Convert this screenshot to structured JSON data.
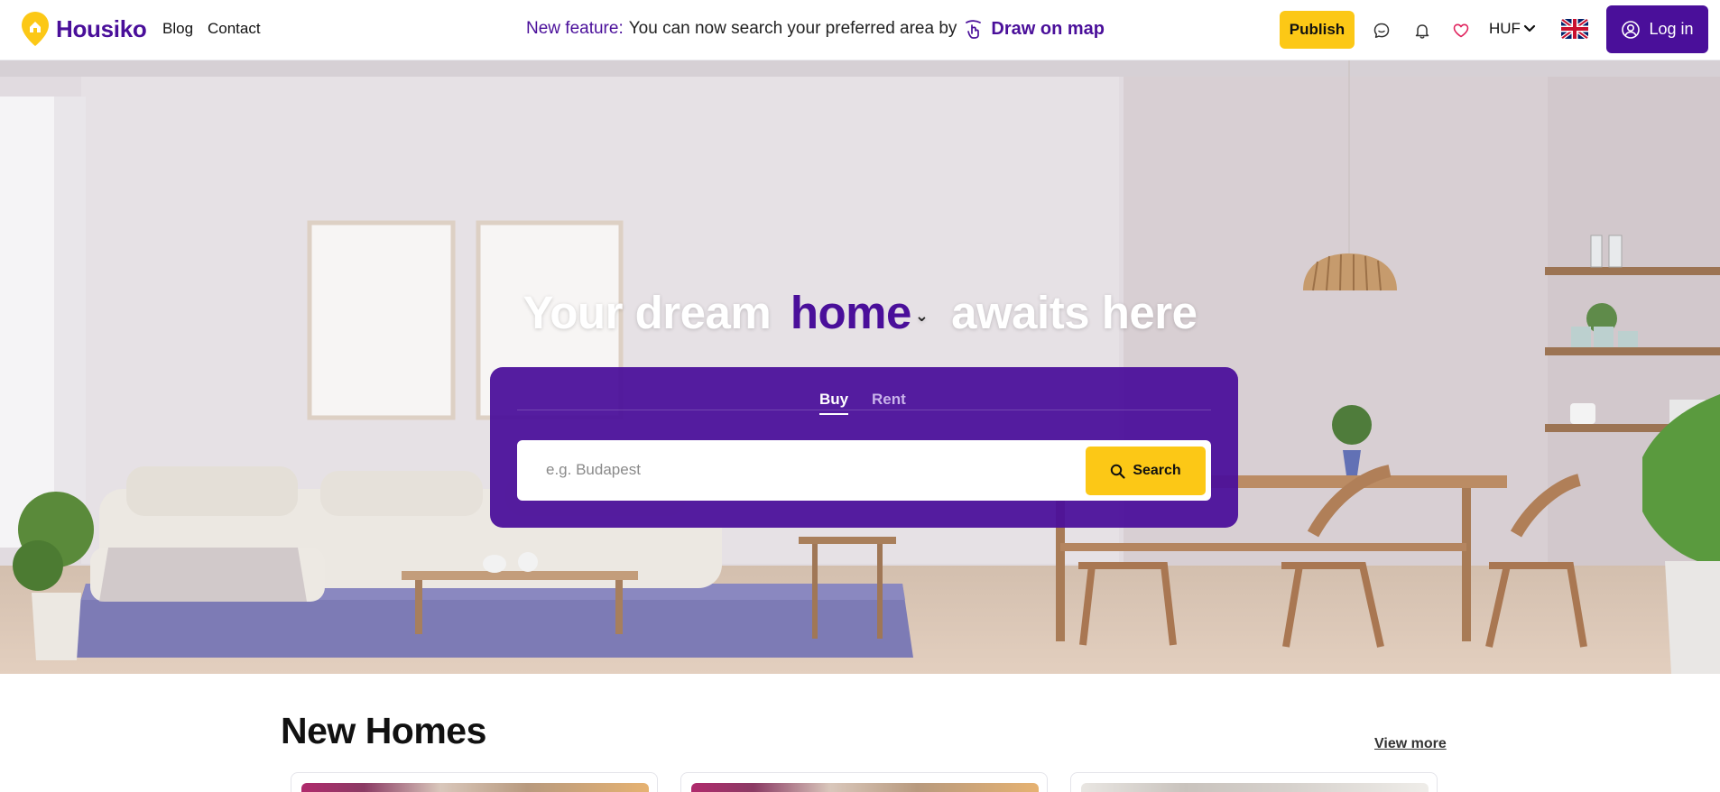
{
  "header": {
    "logo_text": "Housiko",
    "nav": {
      "blog": "Blog",
      "contact": "Contact"
    },
    "announcement": {
      "lead": "New feature:",
      "text": "You can now search your preferred area by",
      "link": "Draw on map"
    },
    "publish_label": "Publish",
    "currency": "HUF",
    "login_label": "Log in"
  },
  "hero": {
    "title_before": "Your dream",
    "title_highlight": "home",
    "title_after": "awaits here",
    "tabs": [
      {
        "label": "Buy",
        "active": true
      },
      {
        "label": "Rent",
        "active": false
      }
    ],
    "search_placeholder": "e.g. Budapest",
    "search_label": "Search"
  },
  "new_homes": {
    "title": "New Homes",
    "view_more": "View more",
    "card_count": 3
  },
  "colors": {
    "brand_purple": "#4a0f9a",
    "accent_yellow": "#fcc816",
    "favorite_pink": "#e0245e"
  },
  "icons": [
    "logo-pin-icon",
    "draw-map-icon",
    "chat-icon",
    "bell-icon",
    "heart-icon",
    "chevron-down-icon",
    "uk-flag-icon",
    "user-circle-icon",
    "search-icon"
  ]
}
